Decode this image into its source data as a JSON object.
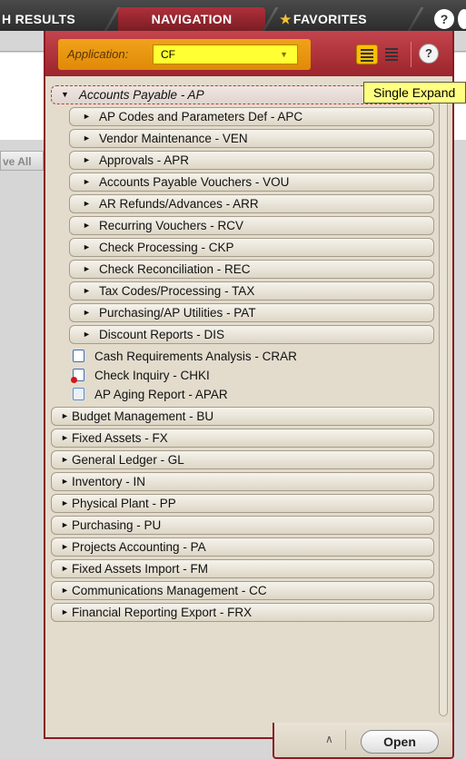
{
  "tabs": {
    "results": "H RESULTS",
    "navigation": "NAVIGATION",
    "favorites": "FAVORITES",
    "help": "?"
  },
  "background": {
    "save_all": "ve All"
  },
  "header": {
    "application_label": "Application:",
    "application_value": "CF",
    "help": "?"
  },
  "tooltip": "Single Expand",
  "tree": {
    "open_module": "Accounts Payable - AP",
    "submenus": [
      "AP Codes and Parameters Def - APC",
      "Vendor Maintenance - VEN",
      "Approvals - APR",
      "Accounts Payable Vouchers - VOU",
      "AR Refunds/Advances - ARR",
      "Recurring Vouchers - RCV",
      "Check Processing - CKP",
      "Check Reconciliation - REC",
      "Tax Codes/Processing - TAX",
      "Purchasing/AP Utilities - PAT",
      "Discount Reports - DIS"
    ],
    "leaves": [
      "Cash Requirements Analysis - CRAR",
      "Check Inquiry - CHKI",
      "AP Aging Report - APAR"
    ],
    "modules": [
      "Budget Management - BU",
      "Fixed Assets - FX",
      "General Ledger - GL",
      "Inventory - IN",
      "Physical Plant - PP",
      "Purchasing - PU",
      "Projects Accounting - PA",
      "Fixed Assets Import - FM",
      "Communications Management - CC",
      "Financial Reporting Export - FRX"
    ]
  },
  "footer": {
    "collapse": "∧",
    "open": "Open"
  },
  "colors": {
    "accent": "#9c242c",
    "application_bg": "#f0a21a",
    "select_bg": "#ffff33"
  }
}
